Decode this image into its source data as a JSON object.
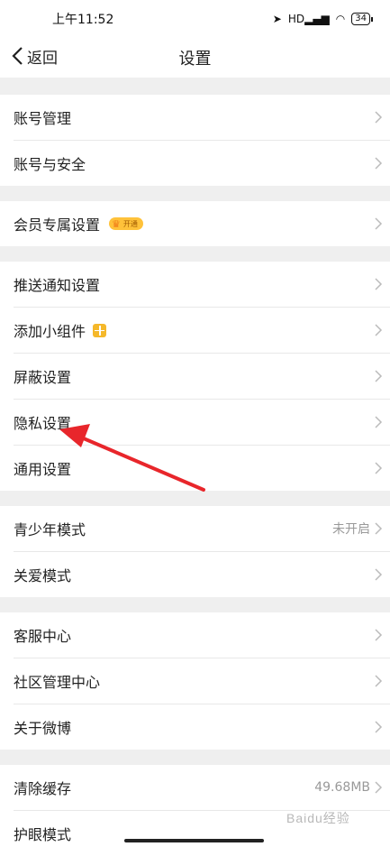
{
  "status_bar": {
    "time": "上午11:52",
    "battery": "34",
    "network": "HD"
  },
  "nav": {
    "back_label": "返回",
    "title": "设置"
  },
  "groups": [
    {
      "items": [
        {
          "label": "账号管理"
        },
        {
          "label": "账号与安全"
        }
      ]
    },
    {
      "items": [
        {
          "label": "会员专属设置",
          "badge": "开通"
        }
      ]
    },
    {
      "items": [
        {
          "label": "推送通知设置"
        },
        {
          "label": "添加小组件"
        },
        {
          "label": "屏蔽设置"
        },
        {
          "label": "隐私设置"
        },
        {
          "label": "通用设置"
        }
      ]
    },
    {
      "items": [
        {
          "label": "青少年模式",
          "value": "未开启"
        },
        {
          "label": "关爱模式"
        }
      ]
    },
    {
      "items": [
        {
          "label": "客服中心"
        },
        {
          "label": "社区管理中心"
        },
        {
          "label": "关于微博"
        }
      ]
    },
    {
      "items": [
        {
          "label": "清除缓存",
          "value": "49.68MB"
        },
        {
          "label": "护眼模式"
        }
      ]
    }
  ],
  "watermark": "Baidu经验",
  "colors": {
    "background": "#ffffff",
    "section_gap": "#efefef",
    "badge": "#ffc23a",
    "annotation_arrow": "#e8262b",
    "widget_icon": "#f5b82a"
  }
}
